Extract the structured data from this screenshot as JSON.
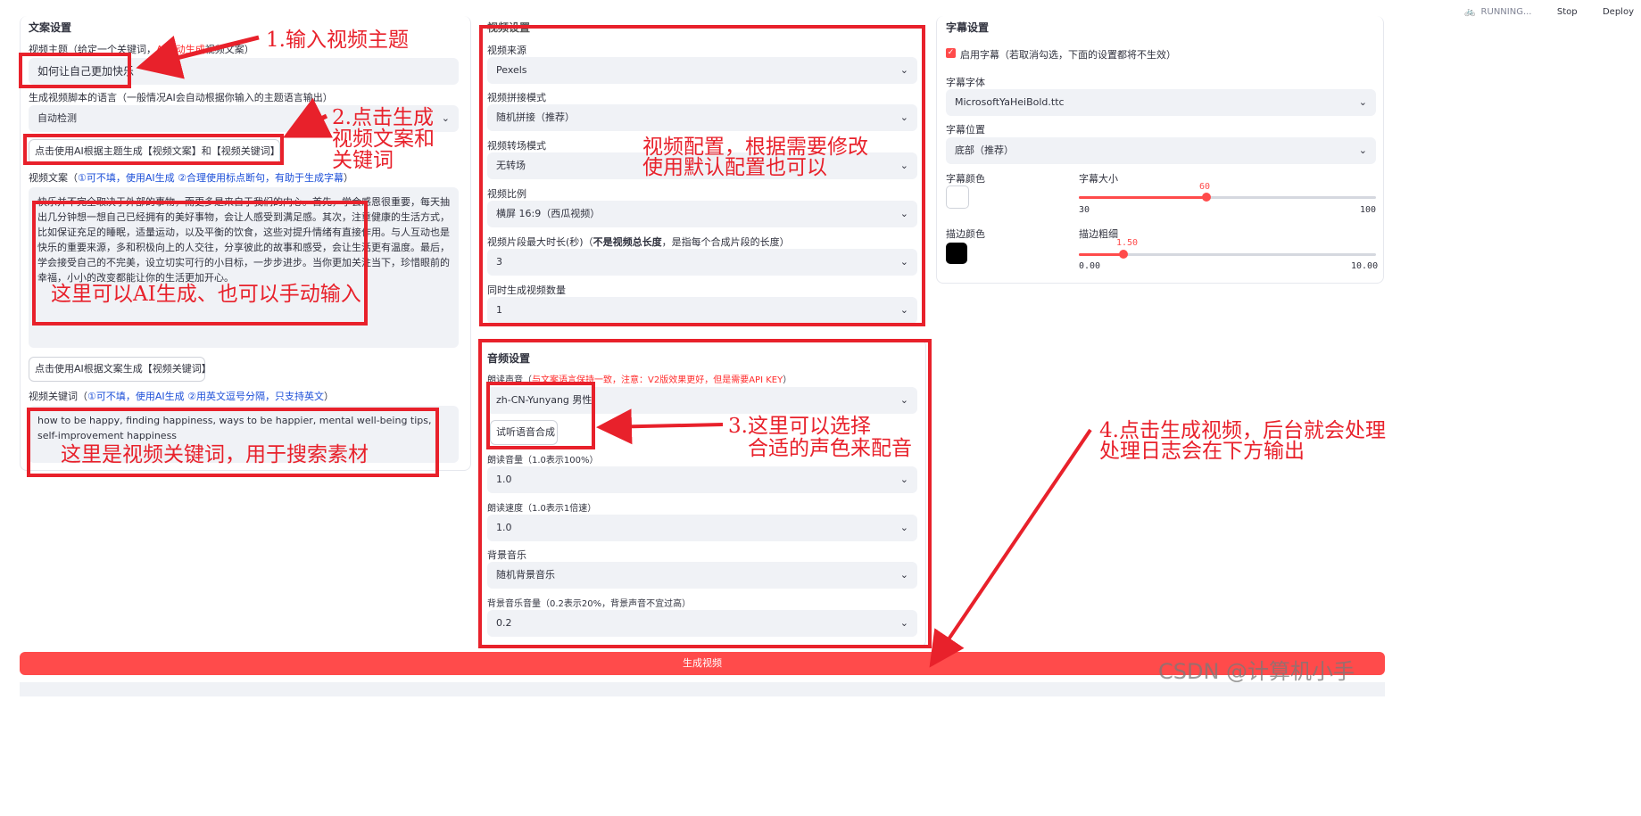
{
  "topbar": {
    "running": "RUNNING...",
    "stop": "Stop",
    "deploy": "Deploy"
  },
  "left": {
    "section_title": "文案设置",
    "topic_label_prefix": "视频主题（给定一个关键词，",
    "topic_label_red": "AI自动生成",
    "topic_label_suffix": "视频文案）",
    "topic_value": "如何让自己更加快乐",
    "lang_label": "生成视频脚本的语言（一般情况AI会自动根据你输入的主题语言输出）",
    "lang_value": "自动检测",
    "gen_script_button": "点击使用AI根据主题生成【视频文案】和【视频关键词】",
    "script_label_prefix": "视频文案（",
    "script_label_blue": "①可不填，使用AI生成 ②合理使用标点断句，有助于生成字幕",
    "script_label_suffix": "）",
    "script_text": "快乐并不完全取决于外部的事物，而更多是来自于我们的内心。首先，学会感恩很重要，每天抽出几分钟想一想自己已经拥有的美好事物，会让人感受到满足感。其次，注重健康的生活方式，比如保证充足的睡眠，适量运动，以及平衡的饮食，这些对提升情绪有直接作用。与人互动也是快乐的重要来源，多和积极向上的人交往，分享彼此的故事和感受，会让生活更有温度。最后，学会接受自己的不完美，设立切实可行的小目标，一步步进步。当你更加关注当下，珍惜眼前的幸福，小小的改变都能让你的生活更加开心。",
    "gen_kw_button": "点击使用AI根据文案生成【视频关键词】",
    "kw_label_prefix": "视频关键词（",
    "kw_label_blue": "①可不填，使用AI生成 ②用英文逗号分隔，只支持英文",
    "kw_label_suffix": "）",
    "kw_text": "how to be happy, finding happiness, ways to be happier, mental well-being tips, self-improvement happiness"
  },
  "middle": {
    "section_title": "视频设置",
    "source_label": "视频来源",
    "source_value": "Pexels",
    "concat_label": "视频拼接模式",
    "concat_value": "随机拼接（推荐）",
    "transition_label": "视频转场模式",
    "transition_value": "无转场",
    "ratio_label": "视频比例",
    "ratio_value": "横屏 16:9（西瓜视频）",
    "clip_label_prefix": "视频片段最大时长(秒)（",
    "clip_label_bold": "不是视频总长度",
    "clip_label_suffix": "，是指每个合成片段的长度）",
    "clip_value": "3",
    "count_label": "同时生成视频数量",
    "count_value": "1"
  },
  "audio": {
    "section_title": "音频设置",
    "voice_label_prefix": "朗读声音（",
    "voice_label_red": "与文案语言保持一致，注意：V2版效果更好，但是需要API KEY",
    "voice_label_suffix": "）",
    "voice_value": "zh-CN-Yunyang 男性",
    "try_button": "试听语音合成",
    "volume_label": "朗读音量（1.0表示100%）",
    "volume_value": "1.0",
    "speed_label": "朗读速度（1.0表示1倍速）",
    "speed_value": "1.0",
    "bgm_label": "背景音乐",
    "bgm_value": "随机背景音乐",
    "bgm_vol_label": "背景音乐音量（0.2表示20%，背景声音不宜过高）",
    "bgm_vol_value": "0.2"
  },
  "subtitle": {
    "section_title": "字幕设置",
    "enable_label": "启用字幕（若取消勾选，下面的设置都将不生效）",
    "font_label": "字幕字体",
    "font_value": "MicrosoftYaHeiBold.ttc",
    "position_label": "字幕位置",
    "position_value": "底部（推荐）",
    "color_label": "字幕颜色",
    "size_label": "字幕大小",
    "size_value": "60",
    "size_min": "30",
    "size_max": "100",
    "size_fraction": 0.43,
    "stroke_color_label": "描边颜色",
    "stroke_width_label": "描边粗细",
    "stroke_value": "1.50",
    "stroke_min": "0.00",
    "stroke_max": "10.00",
    "stroke_fraction": 0.15,
    "font_color": "#ffffff",
    "stroke_color": "#000000"
  },
  "generate_button": "生成视频",
  "annotations": {
    "a1": "1.输入视频主题",
    "a2_l1": "2.点击生成",
    "a2_l2": "视频文案和",
    "a2_l3": "关键词",
    "a_script": "这里可以AI生成、也可以手动输入",
    "a_kw": "这里是视频关键词，用于搜索素材",
    "a_video_l1": "视频配置，根据需要修改",
    "a_video_l2": "使用默认配置也可以",
    "a3_l1": "3.这里可以选择",
    "a3_l2": "合适的声色来配音",
    "a4_l1": "4.点击生成视频，后台就会处理",
    "a4_l2": "处理日志会在下方输出"
  },
  "watermark": "CSDN @计算机小手"
}
